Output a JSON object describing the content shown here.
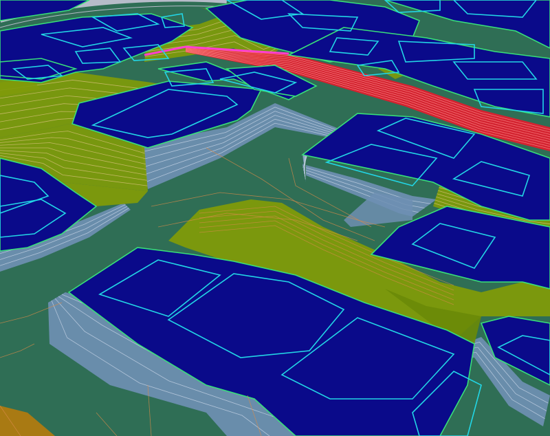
{
  "colors": {
    "ground": "#2f6e55",
    "ground_dark": "#2a6650",
    "pad_top": "#0a0a8a",
    "pad_outline": "#38e07a",
    "footprint": "#22d6e6",
    "slope_fill": "#7f9a0a",
    "slope_lines": "#d6c078",
    "embankment_fill": "#6f8fb3",
    "embankment_lines": "#c6d3e6",
    "road_fill": "#e21c2e",
    "road_lines": "#ff8a8a",
    "contour": "#d98b4a",
    "top_arc": "#b7bcc9",
    "corner_fill": "#b07a10"
  }
}
